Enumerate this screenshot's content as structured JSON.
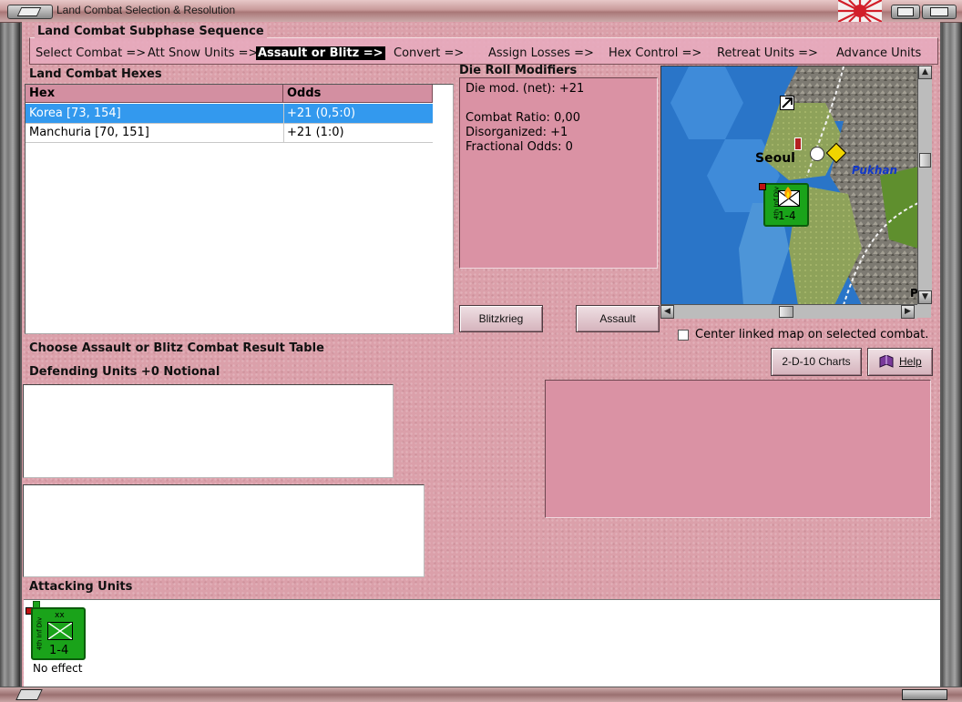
{
  "window": {
    "title": "Land Combat Selection & Resolution"
  },
  "subphase": {
    "legend": "Land Combat Subphase Sequence",
    "steps": [
      "Select Combat =>",
      "Att Snow Units =>",
      "Assault or Blitz =>",
      "Convert =>",
      "Assign Losses =>",
      "Hex Control =>",
      "Retreat Units =>",
      "Advance Units"
    ],
    "active_index": 2
  },
  "hexes": {
    "heading": "Land Combat Hexes",
    "columns": [
      "Hex",
      "Odds"
    ],
    "rows": [
      {
        "hex": "Korea [73, 154]",
        "odds": "+21 (0,5:0)",
        "selected": true
      },
      {
        "hex": "Manchuria [70, 151]",
        "odds": "+21 (1:0)",
        "selected": false
      }
    ]
  },
  "die_roll": {
    "heading": "Die Roll Modifiers",
    "lines": [
      "Die mod. (net): +21",
      "",
      "Combat Ratio: 0,00",
      "Disorganized: +1",
      "Fractional Odds: 0"
    ]
  },
  "buttons": {
    "blitzkrieg": "Blitzkrieg",
    "assault": "Assault",
    "charts": "2-D-10 Charts",
    "help": "Help"
  },
  "map": {
    "city_label": "Seoul",
    "region_label": "Pukhan",
    "unit_value": "1-4",
    "unit_side_text": "4th Inf Div",
    "edge_letter": "P"
  },
  "center_option": {
    "label": "Center linked map on selected combat.",
    "checked": false
  },
  "choose_heading": "Choose Assault or Blitz Combat Result Table",
  "defending_heading": "Defending Units +0 Notional",
  "attacking": {
    "heading": "Attacking Units",
    "units": [
      {
        "size": "xx",
        "side_text": "4th Inf Div",
        "value": "1-4",
        "result": "No effect"
      }
    ]
  },
  "colors": {
    "pane": "#dba0aa",
    "header_cells": "#d38fa1",
    "selection": "#3399ee",
    "unit_green": "#1aa31a"
  },
  "icons": [
    "japan-rising-sun-icon",
    "book-icon",
    "infantry-symbol-icon",
    "attack-flame-icon",
    "checkbox-icon"
  ]
}
